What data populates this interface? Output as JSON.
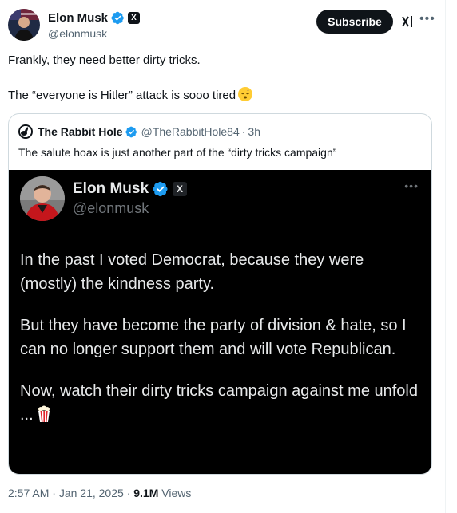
{
  "author": {
    "display_name": "Elon Musk",
    "handle": "@elonmusk"
  },
  "header": {
    "subscribe_label": "Subscribe",
    "x_badge": "X",
    "icons": [
      "verified-badge-icon",
      "grok-icon",
      "more-icon"
    ]
  },
  "tweet": {
    "line1": "Frankly, they need better dirty tricks.",
    "line2": "The “everyone is Hitler” attack is sooo tired",
    "emoji": "sleepy-face-emoji"
  },
  "quote": {
    "display_name": "The Rabbit Hole",
    "handle": "@TheRabbitHole84",
    "separator": "·",
    "time": "3h",
    "text": "The salute hoax is just another part of the “dirty tricks campaign”"
  },
  "quote_image": {
    "display_name": "Elon Musk",
    "handle": "@elonmusk",
    "x_badge": "X",
    "para1": "In the past I voted Democrat, because they were (mostly) the kindness party.",
    "para2": "But they have become the party of division & hate, so I can no longer support them and will vote Republican.",
    "para3": "Now, watch their dirty tricks campaign against me unfold ...",
    "emoji": "popcorn-emoji"
  },
  "footer": {
    "time": "2:57 AM",
    "separator": "·",
    "date": "Jan 21, 2025",
    "views_count": "9.1M",
    "views_label": "Views"
  },
  "colors": {
    "verified_blue": "#1d9bf0",
    "text_primary": "#0f1419",
    "text_secondary": "#536471",
    "border": "#cfd9de"
  }
}
